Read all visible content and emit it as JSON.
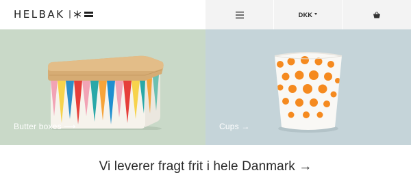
{
  "header": {
    "logo": {
      "text": "HELBAK",
      "mark_icon": "asterisk-flag-logo-mark"
    },
    "menu": {
      "icon": "hamburger-menu-icon"
    },
    "currency": {
      "label": "DKK",
      "icon": "caret-down-icon"
    },
    "cart": {
      "icon": "shopping-basket-icon"
    }
  },
  "tiles": [
    {
      "label": "Butter boxes ⟶",
      "product": "butter-box-image"
    },
    {
      "label": "Cups →",
      "product": "dotted-cup-image"
    }
  ],
  "banner": {
    "text": "Vi leverer fragt frit i hele Danmark →"
  },
  "colors": {
    "tile_left_bg": "#c9d9c8",
    "tile_right_bg": "#c5d4d9",
    "header_cell_bg": "#f3f3f3",
    "dot_orange": "#f58a1f"
  }
}
